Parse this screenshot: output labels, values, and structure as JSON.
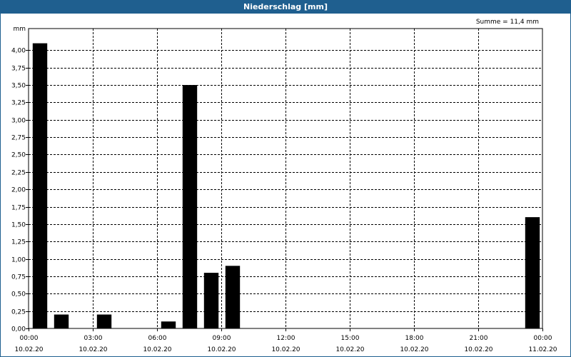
{
  "window": {
    "title": "Niederschlag [mm]"
  },
  "summary": "Summe = 11,4 mm",
  "chart_data": {
    "type": "bar",
    "title": "Niederschlag [mm]",
    "ylabel": "mm",
    "xlabel": "",
    "ylim": [
      0,
      4.25
    ],
    "y_ticks": [
      "0,00",
      "0,25",
      "0,50",
      "0,75",
      "1,00",
      "1,25",
      "1,50",
      "1,75",
      "2,00",
      "2,25",
      "2,50",
      "2,75",
      "3,00",
      "3,25",
      "3,50",
      "3,75",
      "4,00"
    ],
    "x_ticks": [
      {
        "time": "00:00",
        "date": "10.02.20"
      },
      {
        "time": "03:00",
        "date": "10.02.20"
      },
      {
        "time": "06:00",
        "date": "10.02.20"
      },
      {
        "time": "09:00",
        "date": "10.02.20"
      },
      {
        "time": "12:00",
        "date": "10.02.20"
      },
      {
        "time": "15:00",
        "date": "10.02.20"
      },
      {
        "time": "18:00",
        "date": "10.02.20"
      },
      {
        "time": "21:00",
        "date": "10.02.20"
      },
      {
        "time": "00:00",
        "date": "11.02.20"
      }
    ],
    "x_range_hours": [
      0,
      24
    ],
    "bar_interval_hours": 1,
    "grid": true,
    "color": "#000000",
    "bars": [
      {
        "hour": 0,
        "value": 4.1
      },
      {
        "hour": 1,
        "value": 0.2
      },
      {
        "hour": 3,
        "value": 0.2
      },
      {
        "hour": 6,
        "value": 0.1
      },
      {
        "hour": 7,
        "value": 3.5
      },
      {
        "hour": 8,
        "value": 0.8
      },
      {
        "hour": 9,
        "value": 0.9
      },
      {
        "hour": 23,
        "value": 1.6
      }
    ]
  }
}
